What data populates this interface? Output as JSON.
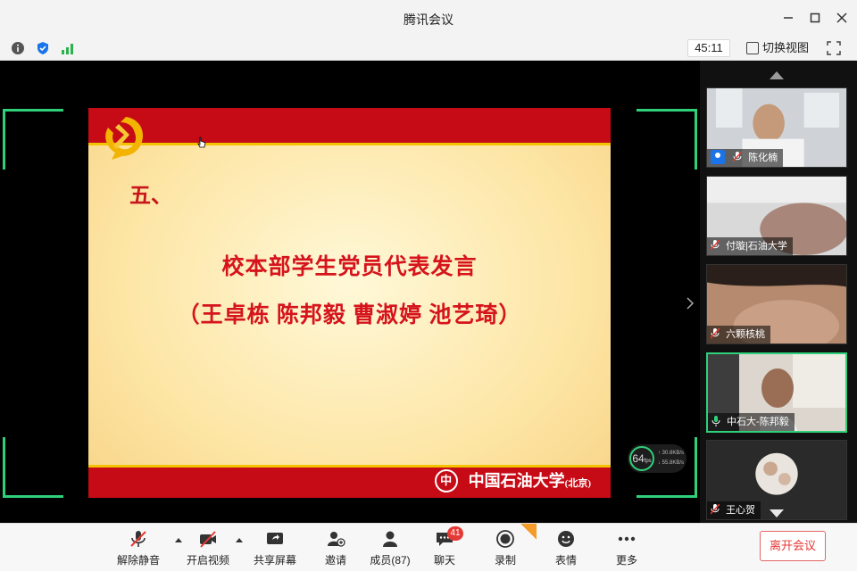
{
  "window": {
    "title": "腾讯会议"
  },
  "infobar": {
    "timer": "45:11",
    "switch_view_label": "切换视图"
  },
  "slide": {
    "section": "五、",
    "heading": "校本部学生党员代表发言",
    "speakers": "（王卓栋  陈邦毅  曹淑婷  池艺琦）",
    "university": "中国石油大学",
    "campus": "(北京)"
  },
  "network": {
    "fps": "64",
    "fps_unit": "fps",
    "up_rate": "30.8",
    "down_rate": "55.8",
    "rate_unit": "KB/s"
  },
  "participants": [
    {
      "name": "陈化楠"
    },
    {
      "name": "付璇|石油大学"
    },
    {
      "name": "六颗核桃"
    },
    {
      "name": "中石大-陈邦毅"
    },
    {
      "name": "王心贺"
    }
  ],
  "toolbar": {
    "unmute": "解除静音",
    "start_video": "开启视频",
    "share_screen": "共享屏幕",
    "invite": "邀请",
    "members": "成员(87)",
    "chat": "聊天",
    "chat_badge": "41",
    "record": "录制",
    "reactions": "表情",
    "more": "更多",
    "leave": "离开会议"
  },
  "colors": {
    "accent_green": "#2fd07a",
    "slide_red": "#c60b16",
    "leave_red": "#e53935"
  }
}
